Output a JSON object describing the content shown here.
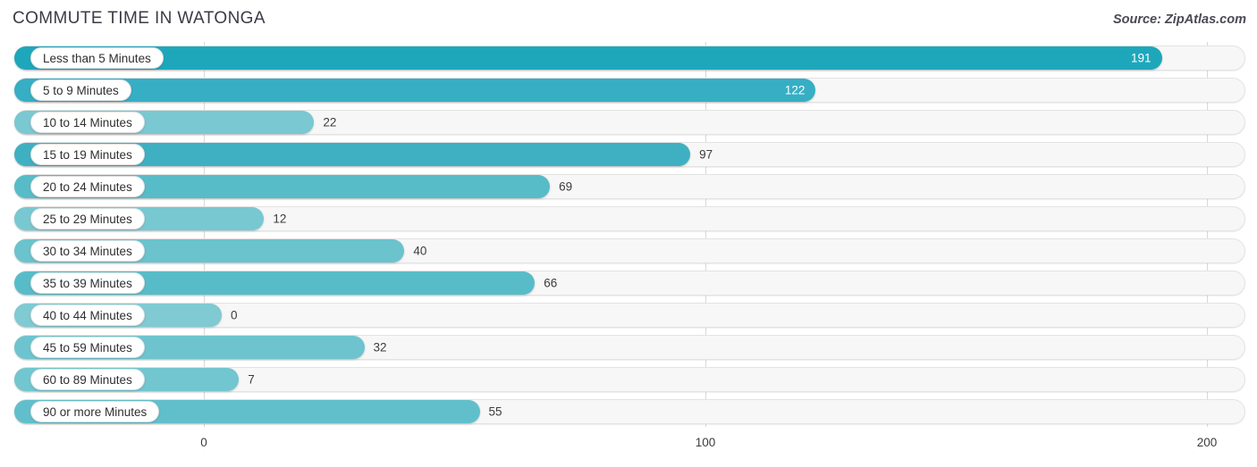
{
  "header": {
    "title": "COMMUTE TIME IN WATONGA",
    "source": "Source: ZipAtlas.com"
  },
  "chart_data": {
    "type": "bar",
    "orientation": "horizontal",
    "title": "COMMUTE TIME IN WATONGA",
    "xlabel": "",
    "ylabel": "",
    "xlim": [
      0,
      200
    ],
    "ticks": [
      "0",
      "100",
      "200"
    ],
    "tick_values": [
      0,
      100,
      200
    ],
    "grid": true,
    "legend": false,
    "categories": [
      "Less than 5 Minutes",
      "5 to 9 Minutes",
      "10 to 14 Minutes",
      "15 to 19 Minutes",
      "20 to 24 Minutes",
      "25 to 29 Minutes",
      "30 to 34 Minutes",
      "35 to 39 Minutes",
      "40 to 44 Minutes",
      "45 to 59 Minutes",
      "60 to 89 Minutes",
      "90 or more Minutes"
    ],
    "values": [
      191,
      122,
      22,
      97,
      69,
      12,
      40,
      66,
      0,
      32,
      7,
      55
    ],
    "value_labels": [
      "191",
      "122",
      "22",
      "97",
      "69",
      "12",
      "40",
      "66",
      "0",
      "32",
      "7",
      "55"
    ],
    "bar_colors": [
      "#1ea7bb",
      "#36aec4",
      "#79c8d2",
      "#3fb0c2",
      "#57bcc8",
      "#78c8d1",
      "#6ac3cd",
      "#58bcc8",
      "#7fcad3",
      "#6dc4ce",
      "#72c6cf",
      "#61bfcb"
    ],
    "label_inside": [
      true,
      true,
      false,
      false,
      false,
      false,
      false,
      false,
      false,
      false,
      false,
      false
    ]
  },
  "colors": {
    "accent": "#3fb0c2",
    "track": "#f7f7f7",
    "grid": "#d8d8d8",
    "text": "#3c3c3c"
  }
}
